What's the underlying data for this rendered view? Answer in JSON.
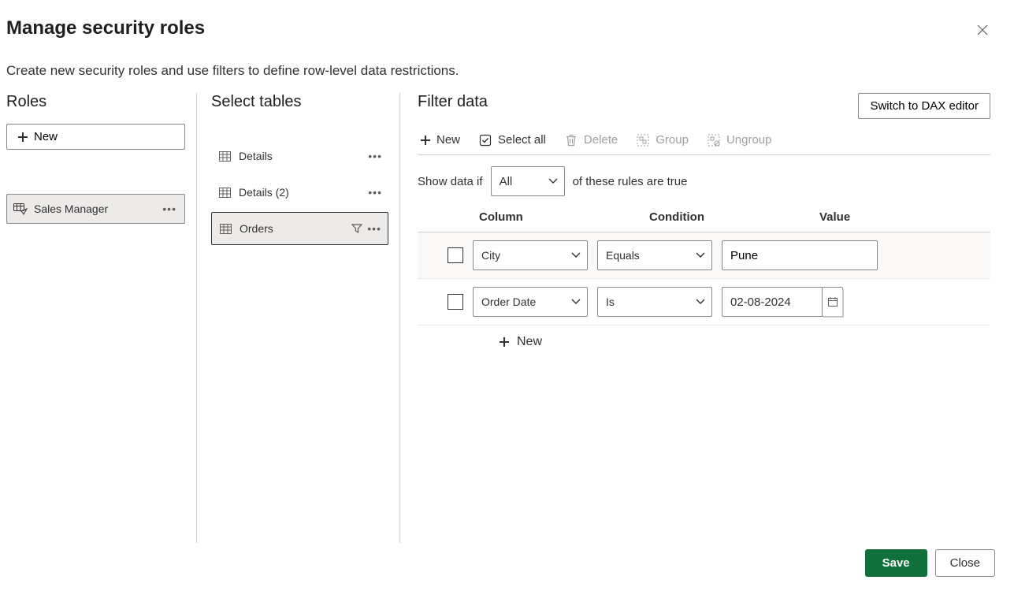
{
  "header": {
    "title": "Manage security roles",
    "subtitle": "Create new security roles and use filters to define row-level data restrictions."
  },
  "roles": {
    "heading": "Roles",
    "new_label": "New",
    "items": [
      {
        "name": "Sales Manager"
      }
    ]
  },
  "tables": {
    "heading": "Select tables",
    "items": [
      {
        "name": "Details",
        "selected": false,
        "filtered": false
      },
      {
        "name": "Details (2)",
        "selected": false,
        "filtered": false
      },
      {
        "name": "Orders",
        "selected": true,
        "filtered": true
      }
    ]
  },
  "filter": {
    "heading": "Filter data",
    "switch_label": "Switch to DAX editor",
    "toolbar": {
      "new": "New",
      "select_all": "Select all",
      "delete": "Delete",
      "group": "Group",
      "ungroup": "Ungroup"
    },
    "sentence": {
      "prefix": "Show data if",
      "operator": "All",
      "suffix": "of these rules are true"
    },
    "columns_header": {
      "column": "Column",
      "condition": "Condition",
      "value": "Value"
    },
    "rules": [
      {
        "column": "City",
        "condition": "Equals",
        "value": "Pune",
        "type": "text"
      },
      {
        "column": "Order Date",
        "condition": "Is",
        "value": "02-08-2024",
        "type": "date"
      }
    ],
    "add_new": "New"
  },
  "footer": {
    "save": "Save",
    "close": "Close"
  }
}
